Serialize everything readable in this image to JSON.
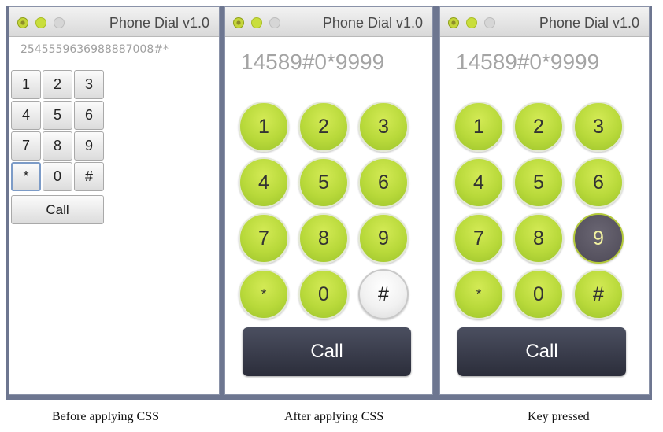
{
  "windows": [
    {
      "title": "Phone Dial v1.0",
      "display": "25455596369888870​08#*",
      "keys": [
        "1",
        "2",
        "3",
        "4",
        "5",
        "6",
        "7",
        "8",
        "9",
        "*",
        "0",
        "#"
      ],
      "call_label": "Call"
    },
    {
      "title": "Phone Dial v1.0",
      "display": "14589#0*9999",
      "keys": [
        "1",
        "2",
        "3",
        "4",
        "5",
        "6",
        "7",
        "8",
        "9",
        "*",
        "0",
        "#"
      ],
      "call_label": "Call"
    },
    {
      "title": "Phone Dial v1.0",
      "display": "14589#0*9999",
      "keys": [
        "1",
        "2",
        "3",
        "4",
        "5",
        "6",
        "7",
        "8",
        "9",
        "*",
        "0",
        "#"
      ],
      "call_label": "Call",
      "pressed_key": "9"
    }
  ],
  "captions": [
    "Before applying CSS",
    "After applying CSS",
    "Key pressed"
  ],
  "colors": {
    "key_green": "#b8d93a",
    "call_dark": "#2b2d3a",
    "pressed_key": "#56525f"
  }
}
